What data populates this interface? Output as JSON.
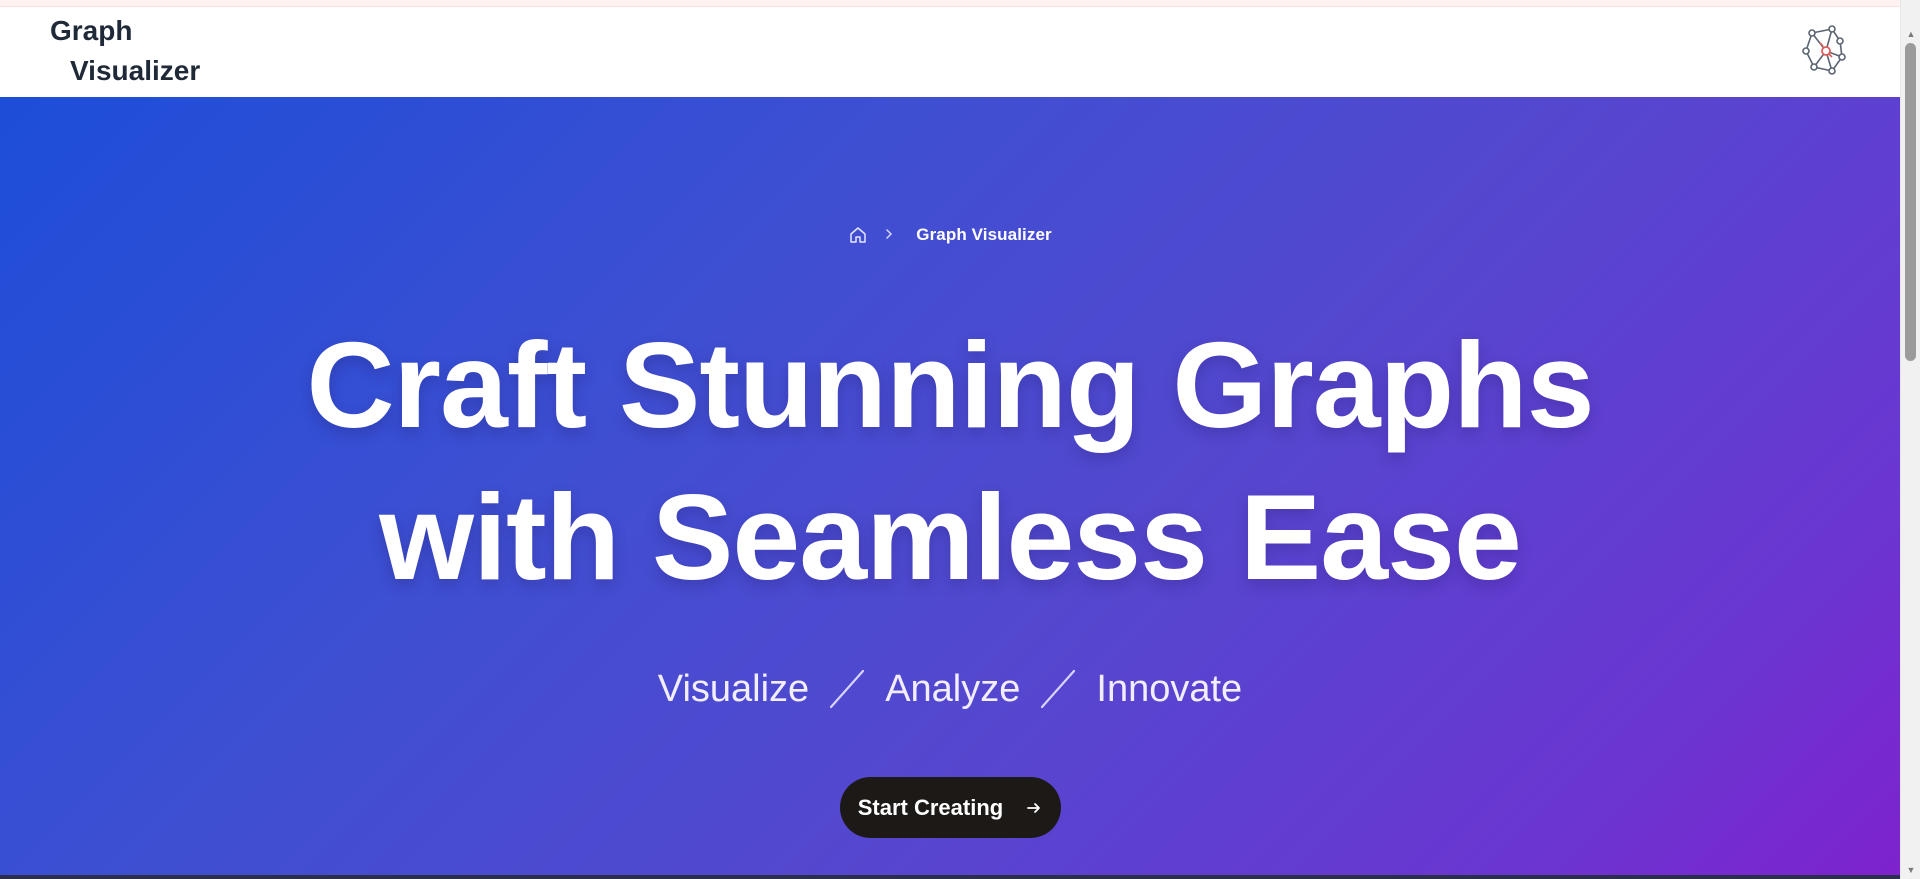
{
  "header": {
    "logo_line1": "Graph",
    "logo_line2": "Visualizer",
    "brand_icon": "graph-network-icon"
  },
  "breadcrumb": {
    "home_icon": "home-icon",
    "separator_icon": "chevron-right-icon",
    "current": "Graph Visualizer"
  },
  "hero": {
    "headline_line1": "Craft Stunning Graphs",
    "headline_line2": "with Seamless Ease",
    "tagline": [
      "Visualize",
      "Analyze",
      "Innovate"
    ],
    "cta_label": "Start Creating",
    "cta_icon": "arrow-right-icon"
  },
  "colors": {
    "gradient_start": "#1d4ed8",
    "gradient_end": "#7e22ce",
    "cta_background": "#1c1917",
    "header_text": "#1f2937"
  }
}
